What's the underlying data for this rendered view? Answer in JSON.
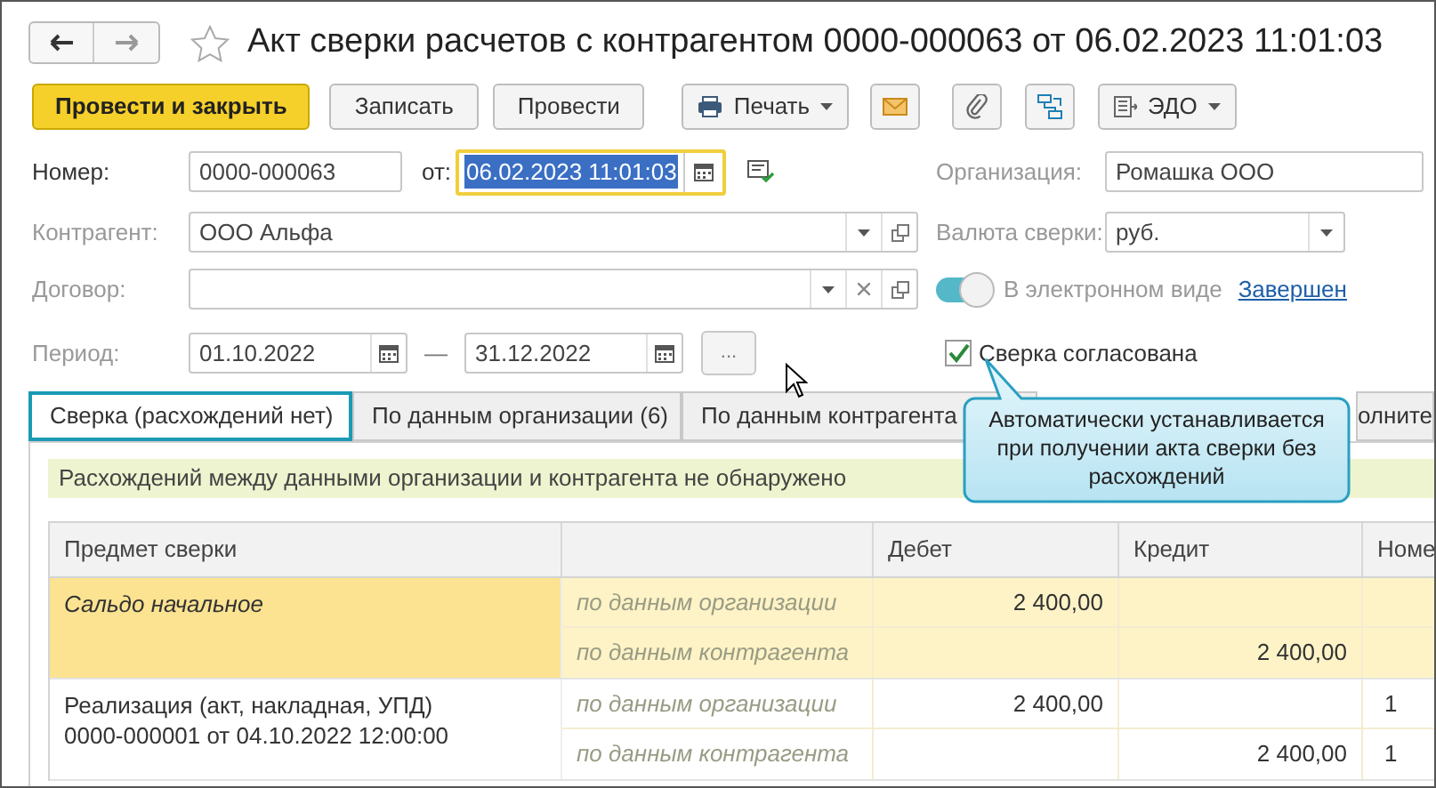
{
  "window": {
    "title": "Акт сверки расчетов с контрагентом 0000-000063 от 06.02.2023 11:01:03"
  },
  "toolbar": [
    {
      "kind": "primary",
      "label": "Провести и закрыть"
    },
    {
      "kind": "button",
      "label": "Записать"
    },
    {
      "kind": "button",
      "label": "Провести"
    },
    {
      "kind": "print-menu",
      "label": "Печать"
    },
    {
      "kind": "mail"
    },
    {
      "kind": "attach"
    },
    {
      "kind": "structure"
    },
    {
      "kind": "edo-menu",
      "label": "ЭДО"
    }
  ],
  "number": {
    "label": "Номер:",
    "value": "0000-000063"
  },
  "date": {
    "label": "от:",
    "value": "06.02.2023 11:01:03",
    "focused": true
  },
  "organization": {
    "label": "Организация:",
    "value": "Ромашка ООО"
  },
  "counterparty": {
    "label": "Контрагент:",
    "value": "ООО Альфа"
  },
  "currency": {
    "label": "Валюта сверки:",
    "value": "руб."
  },
  "contract": {
    "label": "Договор:"
  },
  "electronic": {
    "label": "В электронном виде",
    "on": true,
    "link": "Завершен"
  },
  "period": {
    "label": "Период:",
    "from": "01.10.2022",
    "separator": "—",
    "to": "31.12.2022",
    "button": "..."
  },
  "agreed": {
    "label": "Сверка согласована",
    "checked": true
  },
  "tabs": [
    {
      "label": "Сверка (расхождений нет)",
      "selected": true
    },
    {
      "label": "По данным организации (6)",
      "selected": false
    },
    {
      "label": "По данным контрагента",
      "selected": false
    },
    {
      "label": "олните",
      "selected": false
    }
  ],
  "callout": {
    "text": "Автоматически устанавливается при получении акта сверки без расхождений"
  },
  "info": "Расхождений между данными организации и контрагента не обнаружено",
  "table": {
    "columns": {
      "subject": "Предмет сверки",
      "debit": "Дебет",
      "credit": "Кредит",
      "column_5": "Номе"
    },
    "rows": [
      {
        "kind": "balance",
        "subject": "Сальдо начальное",
        "lines": [
          {
            "source": "по данным организации",
            "debit": "2 400,00"
          },
          {
            "source": "по данным контрагента",
            "credit": "2 400,00"
          }
        ]
      },
      {
        "kind": "document",
        "subject": "Реализация (акт, накладная, УПД)",
        "document": "0000-000001 от 04.10.2022 12:00:00",
        "lines": [
          {
            "source": "по данным организации",
            "debit": "2 400,00",
            "number": "1"
          },
          {
            "source": "по данным контрагента",
            "credit": "2 400,00",
            "number": "1"
          }
        ]
      }
    ]
  }
}
